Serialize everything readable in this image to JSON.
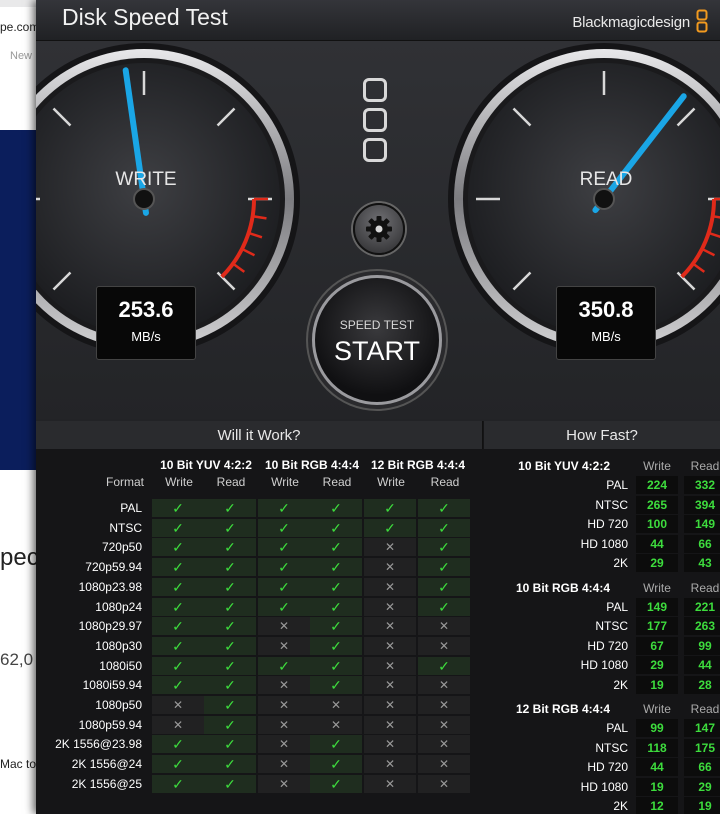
{
  "app": {
    "title": "Disk Speed Test",
    "brand": "Blackmagicdesign"
  },
  "background": {
    "url_fragment": "pe.com",
    "tab_fragment": "New",
    "heading_fragment": "peci",
    "number_fragment": "62,0",
    "text_fragment": "Mac to"
  },
  "gauges": {
    "write": {
      "label": "WRITE",
      "value": "253.6",
      "unit": "MB/s",
      "needle_fraction": 0.47
    },
    "read": {
      "label": "READ",
      "value": "350.8",
      "unit": "MB/s",
      "needle_fraction": 0.64
    }
  },
  "controls": {
    "speed_test_label": "SPEED TEST",
    "start_label": "START"
  },
  "will_it_work": {
    "title": "Will it Work?",
    "format_header": "Format",
    "groups": [
      "10 Bit YUV 4:2:2",
      "10 Bit RGB 4:4:4",
      "12 Bit RGB 4:4:4"
    ],
    "sub_headers": [
      "Write",
      "Read"
    ],
    "rows": [
      {
        "format": "PAL",
        "cells": [
          1,
          1,
          1,
          1,
          1,
          1
        ]
      },
      {
        "format": "NTSC",
        "cells": [
          1,
          1,
          1,
          1,
          1,
          1
        ]
      },
      {
        "format": "720p50",
        "cells": [
          1,
          1,
          1,
          1,
          0,
          1
        ]
      },
      {
        "format": "720p59.94",
        "cells": [
          1,
          1,
          1,
          1,
          0,
          1
        ]
      },
      {
        "format": "1080p23.98",
        "cells": [
          1,
          1,
          1,
          1,
          0,
          1
        ]
      },
      {
        "format": "1080p24",
        "cells": [
          1,
          1,
          1,
          1,
          0,
          1
        ]
      },
      {
        "format": "1080p29.97",
        "cells": [
          1,
          1,
          0,
          1,
          0,
          0
        ]
      },
      {
        "format": "1080p30",
        "cells": [
          1,
          1,
          0,
          1,
          0,
          0
        ]
      },
      {
        "format": "1080i50",
        "cells": [
          1,
          1,
          1,
          1,
          0,
          1
        ]
      },
      {
        "format": "1080i59.94",
        "cells": [
          1,
          1,
          0,
          1,
          0,
          0
        ]
      },
      {
        "format": "1080p50",
        "cells": [
          0,
          1,
          0,
          0,
          0,
          0
        ]
      },
      {
        "format": "1080p59.94",
        "cells": [
          0,
          1,
          0,
          0,
          0,
          0
        ]
      },
      {
        "format": "2K 1556@23.98",
        "cells": [
          1,
          1,
          0,
          1,
          0,
          0
        ]
      },
      {
        "format": "2K 1556@24",
        "cells": [
          1,
          1,
          0,
          1,
          0,
          0
        ]
      },
      {
        "format": "2K 1556@25",
        "cells": [
          1,
          1,
          0,
          1,
          0,
          0
        ]
      }
    ],
    "check_symbol": "✓",
    "cross_symbol": "✕"
  },
  "how_fast": {
    "title": "How Fast?",
    "sub_headers": [
      "Write",
      "Read"
    ],
    "groups": [
      {
        "name": "10 Bit YUV 4:2:2",
        "rows": [
          {
            "format": "PAL",
            "write": "224",
            "read": "332"
          },
          {
            "format": "NTSC",
            "write": "265",
            "read": "394"
          },
          {
            "format": "HD 720",
            "write": "100",
            "read": "149"
          },
          {
            "format": "HD 1080",
            "write": "44",
            "read": "66"
          },
          {
            "format": "2K",
            "write": "29",
            "read": "43"
          }
        ]
      },
      {
        "name": "10 Bit RGB 4:4:4",
        "rows": [
          {
            "format": "PAL",
            "write": "149",
            "read": "221"
          },
          {
            "format": "NTSC",
            "write": "177",
            "read": "263"
          },
          {
            "format": "HD 720",
            "write": "67",
            "read": "99"
          },
          {
            "format": "HD 1080",
            "write": "29",
            "read": "44"
          },
          {
            "format": "2K",
            "write": "19",
            "read": "28"
          }
        ]
      },
      {
        "name": "12 Bit RGB 4:4:4",
        "rows": [
          {
            "format": "PAL",
            "write": "99",
            "read": "147"
          },
          {
            "format": "NTSC",
            "write": "118",
            "read": "175"
          },
          {
            "format": "HD 720",
            "write": "44",
            "read": "66"
          },
          {
            "format": "HD 1080",
            "write": "19",
            "read": "29"
          },
          {
            "format": "2K",
            "write": "12",
            "read": "19"
          }
        ]
      }
    ]
  },
  "colors": {
    "needle": "#1aa6e6",
    "ok": "#3ddc3d",
    "redline": "#e02a1a"
  }
}
